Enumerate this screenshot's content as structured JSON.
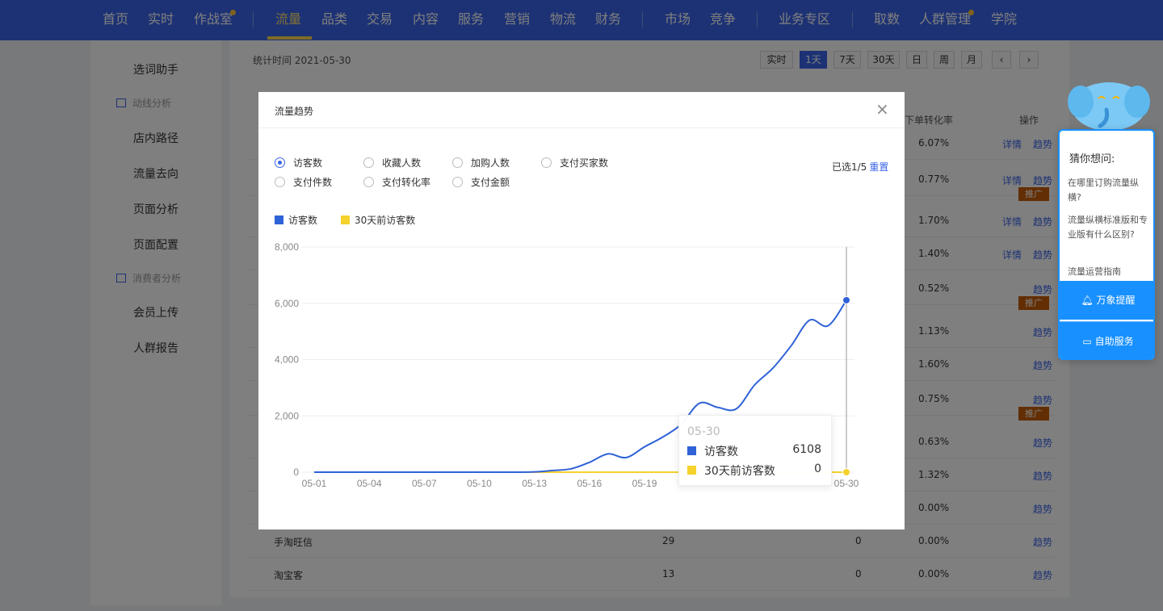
{
  "nav": {
    "items": [
      "首页",
      "实时",
      "作战室",
      "流量",
      "品类",
      "交易",
      "内容",
      "服务",
      "营销",
      "物流",
      "财务",
      "市场",
      "竞争",
      "业务专区",
      "取数",
      "人群管理",
      "学院"
    ],
    "active": "流量"
  },
  "sidebar": {
    "items": [
      "选词助手",
      "动线分析",
      "店内路径",
      "流量去向",
      "页面分析",
      "页面配置",
      "消费者分析",
      "会员上传",
      "人群报告"
    ]
  },
  "main": {
    "stat_time": "统计时间 2021-05-30",
    "time_buttons": [
      "实时",
      "1天",
      "7天",
      "30天",
      "日",
      "周",
      "月"
    ],
    "active_time": "1天",
    "col_conversion": "下单转化率",
    "col_action": "操作",
    "rows": [
      {
        "rate": "6.07%",
        "links": [
          "详情",
          "趋势"
        ],
        "promo": ""
      },
      {
        "rate": "0.77%",
        "links": [
          "详情",
          "趋势"
        ],
        "promo": "推广"
      },
      {
        "rate": "1.70%",
        "links": [
          "详情",
          "趋势"
        ],
        "promo": ""
      },
      {
        "rate": "1.40%",
        "links": [
          "详情",
          "趋势"
        ],
        "promo": ""
      },
      {
        "rate": "0.52%",
        "links": [
          "趋势"
        ],
        "promo": "推广"
      },
      {
        "rate": "1.13%",
        "links": [
          "趋势"
        ],
        "promo": ""
      },
      {
        "rate": "1.60%",
        "links": [
          "趋势"
        ],
        "promo": ""
      },
      {
        "rate": "0.75%",
        "links": [
          "趋势"
        ],
        "promo": "推广"
      },
      {
        "rate": "0.63%",
        "links": [
          "趋势"
        ],
        "promo": ""
      },
      {
        "rate": "1.32%",
        "links": [
          "趋势"
        ],
        "promo": ""
      },
      {
        "rate": "0.00%",
        "links": [
          "趋势"
        ],
        "promo": ""
      },
      {
        "name": "手淘旺信",
        "visitors": "29",
        "buyers": "0",
        "rate": "0.00%",
        "links": [
          "趋势"
        ],
        "promo": ""
      },
      {
        "name": "淘宝客",
        "visitors": "13",
        "buyers": "0",
        "rate": "0.00%",
        "links": [
          "趋势"
        ],
        "promo": ""
      }
    ]
  },
  "modal": {
    "title": "流量趋势",
    "close": "×",
    "options": [
      "访客数",
      "收藏人数",
      "加购人数",
      "支付买家数",
      "支付件数",
      "支付转化率",
      "支付金额"
    ],
    "selected": "访客数",
    "selected_info": "已选1/5",
    "reset": "重置",
    "tooltip": {
      "date": "05-30",
      "rows": [
        {
          "name": "访客数",
          "value": "6108",
          "color": "#2f62d7"
        },
        {
          "name": "30天前访客数",
          "value": "0",
          "color": "#f5d22c"
        }
      ]
    }
  },
  "chart_data": {
    "type": "line",
    "x": [
      "05-01",
      "05-02",
      "05-03",
      "05-04",
      "05-05",
      "05-06",
      "05-07",
      "05-08",
      "05-09",
      "05-10",
      "05-11",
      "05-12",
      "05-13",
      "05-14",
      "05-15",
      "05-16",
      "05-17",
      "05-18",
      "05-19",
      "05-20",
      "05-21",
      "05-22",
      "05-23",
      "05-24",
      "05-25",
      "05-26",
      "05-27",
      "05-28",
      "05-29",
      "05-30"
    ],
    "x_ticks": [
      "05-01",
      "05-04",
      "05-07",
      "05-10",
      "05-13",
      "05-16",
      "05-19",
      "05-30"
    ],
    "series": [
      {
        "name": "访客数",
        "color": "#2f62d7",
        "values": [
          0,
          0,
          0,
          0,
          0,
          0,
          0,
          0,
          0,
          0,
          0,
          0,
          10,
          60,
          120,
          350,
          650,
          520,
          900,
          1250,
          1700,
          2450,
          2300,
          2250,
          3100,
          3700,
          4500,
          5400,
          5200,
          6108
        ]
      },
      {
        "name": "30天前访客数",
        "color": "#f5d22c",
        "values": [
          0,
          0,
          0,
          0,
          0,
          0,
          0,
          0,
          0,
          0,
          0,
          0,
          0,
          0,
          0,
          0,
          0,
          0,
          0,
          0,
          0,
          0,
          0,
          0,
          0,
          0,
          0,
          0,
          0,
          0
        ]
      }
    ],
    "ylim": [
      0,
      8000
    ],
    "y_ticks": [
      "0",
      "2,000",
      "4,000",
      "6,000",
      "8,000"
    ],
    "grid": true,
    "legend": "top-left"
  },
  "helper": {
    "title": "猜你想问:",
    "questions": [
      "在哪里订购流量纵横?",
      "流量纵横标准版和专业版有什么区别?",
      "流量运营指南"
    ],
    "buttons": [
      "万象提醒",
      "自助服务"
    ]
  }
}
